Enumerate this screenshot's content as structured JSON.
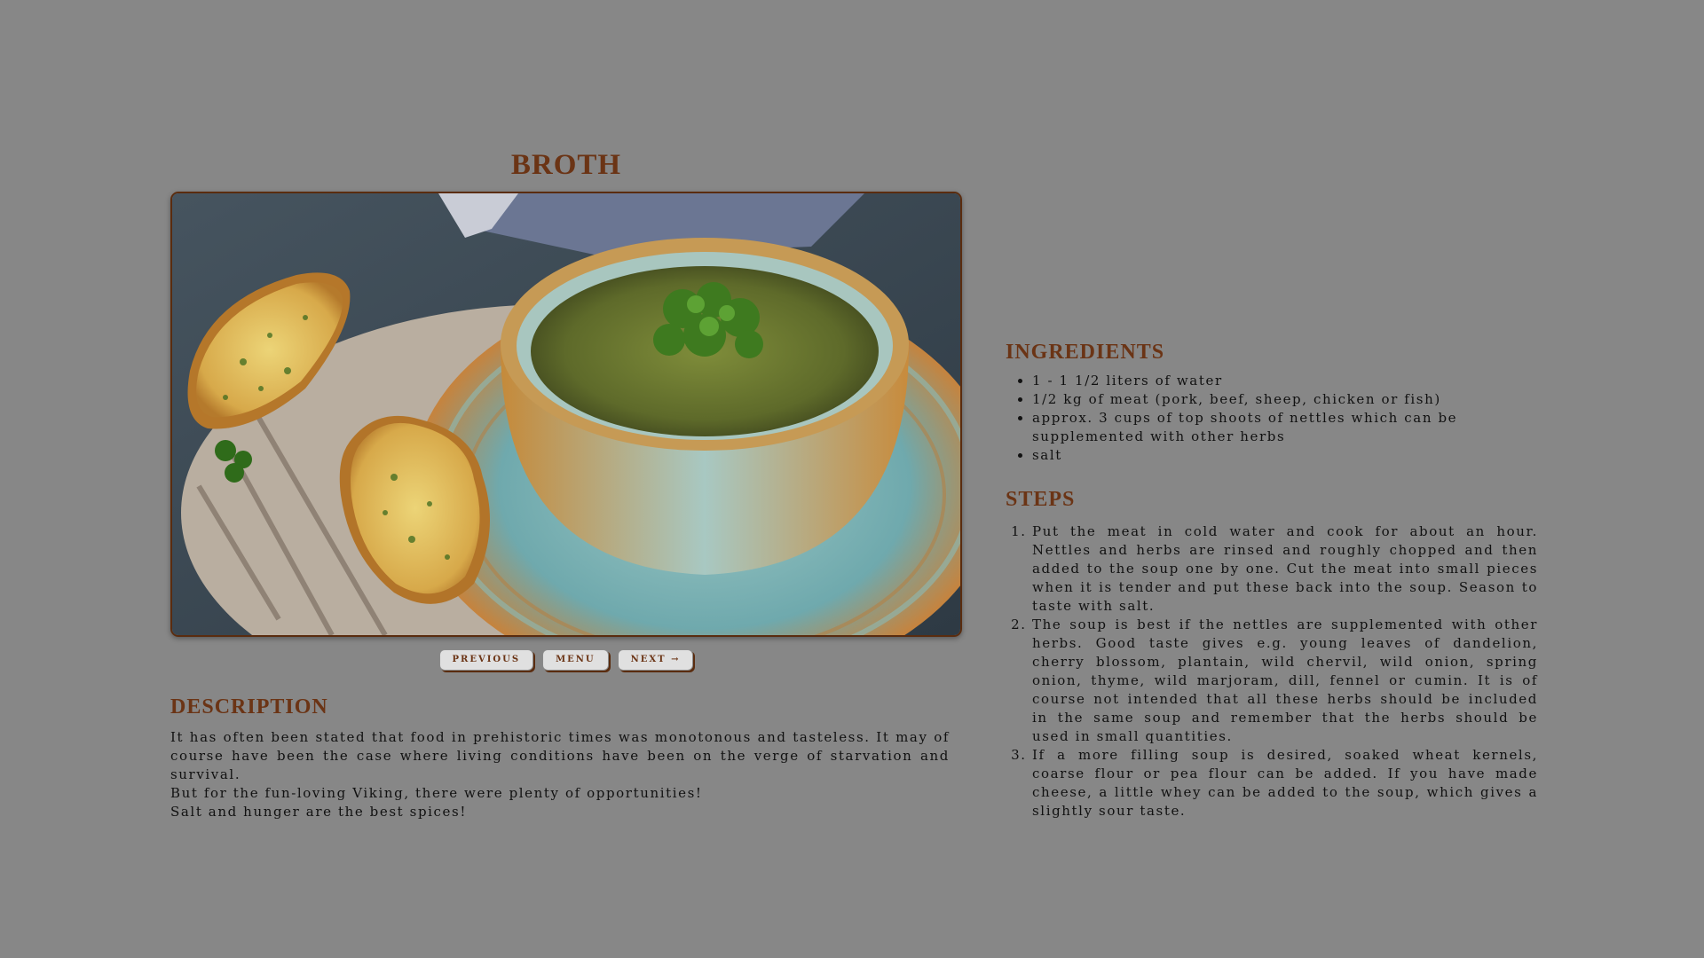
{
  "recipe": {
    "title": "BROTH"
  },
  "nav": {
    "previous_label": "PREVIOUS",
    "menu_label": "MENU",
    "next_label": "NEXT →"
  },
  "description": {
    "heading": "DESCRIPTION",
    "paragraphs": [
      "It has often been stated that food in prehistoric times was monotonous and tasteless. It may of course have been the case where living conditions have been on the verge of starvation and survival.",
      "But for the fun-loving Viking, there were plenty of opportunities!",
      "Salt and hunger are the best spices!"
    ]
  },
  "ingredients": {
    "heading": "INGREDIENTS",
    "items": [
      "1 - 1 1/2 liters of water",
      "1/2 kg of meat (pork, beef, sheep, chicken or fish)",
      "approx. 3 cups of top shoots of nettles which can be supplemented with other herbs",
      "salt"
    ]
  },
  "steps": {
    "heading": "STEPS",
    "items": [
      "Put the meat in cold water and cook for about an hour. Nettles and herbs are rinsed and roughly chopped and then added to the soup one by one. Cut the meat into small pieces when it is tender and put these back into the soup. Season to taste with salt.",
      "The soup is best if the nettles are supplemented with other herbs. Good taste gives e.g. young leaves of dandelion, cherry blossom, plantain, wild chervil, wild onion, spring onion, thyme, wild marjoram, dill, fennel or cumin. It is of course not intended that all these herbs should be included in the same soup and remember that the herbs should be used in small quantities.",
      "If a more filling soup is desired, soaked wheat kernels, coarse flour or pea flour can be added. If you have made cheese, a little whey can be added to the soup, which gives a slightly sour taste."
    ]
  },
  "colors": {
    "background": "#878787",
    "heading": "#6b3415",
    "frame": "#5a2c0f"
  }
}
